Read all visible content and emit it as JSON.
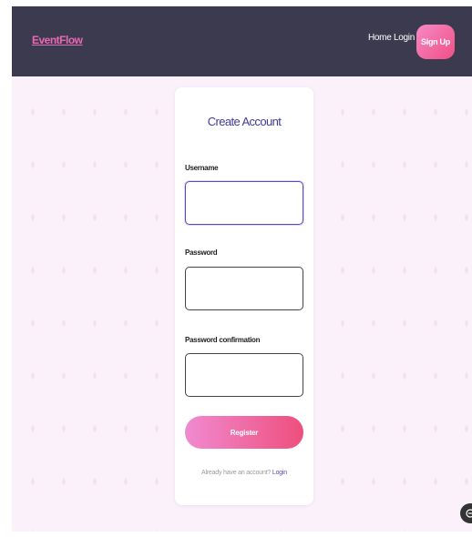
{
  "navbar": {
    "brand": "EventFlow",
    "links": [
      {
        "label": "Home"
      },
      {
        "label": "Login"
      }
    ],
    "signup_label": "Sign Up"
  },
  "form": {
    "title": "Create Account",
    "fields": [
      {
        "label": "Username",
        "value": ""
      },
      {
        "label": "Password",
        "value": ""
      },
      {
        "label": "Password confirmation",
        "value": ""
      }
    ],
    "submit_label": "Register",
    "footer_text": "Already have an account?",
    "footer_link": "Login"
  },
  "colors": {
    "navbar_bg": "#3b3a4f",
    "brand": "#e96ab4",
    "accent_pink": "#f04f85",
    "title": "#3f3a9a",
    "page_bg": "#fbf1fb"
  },
  "icons": {
    "floating": "chat-icon"
  }
}
